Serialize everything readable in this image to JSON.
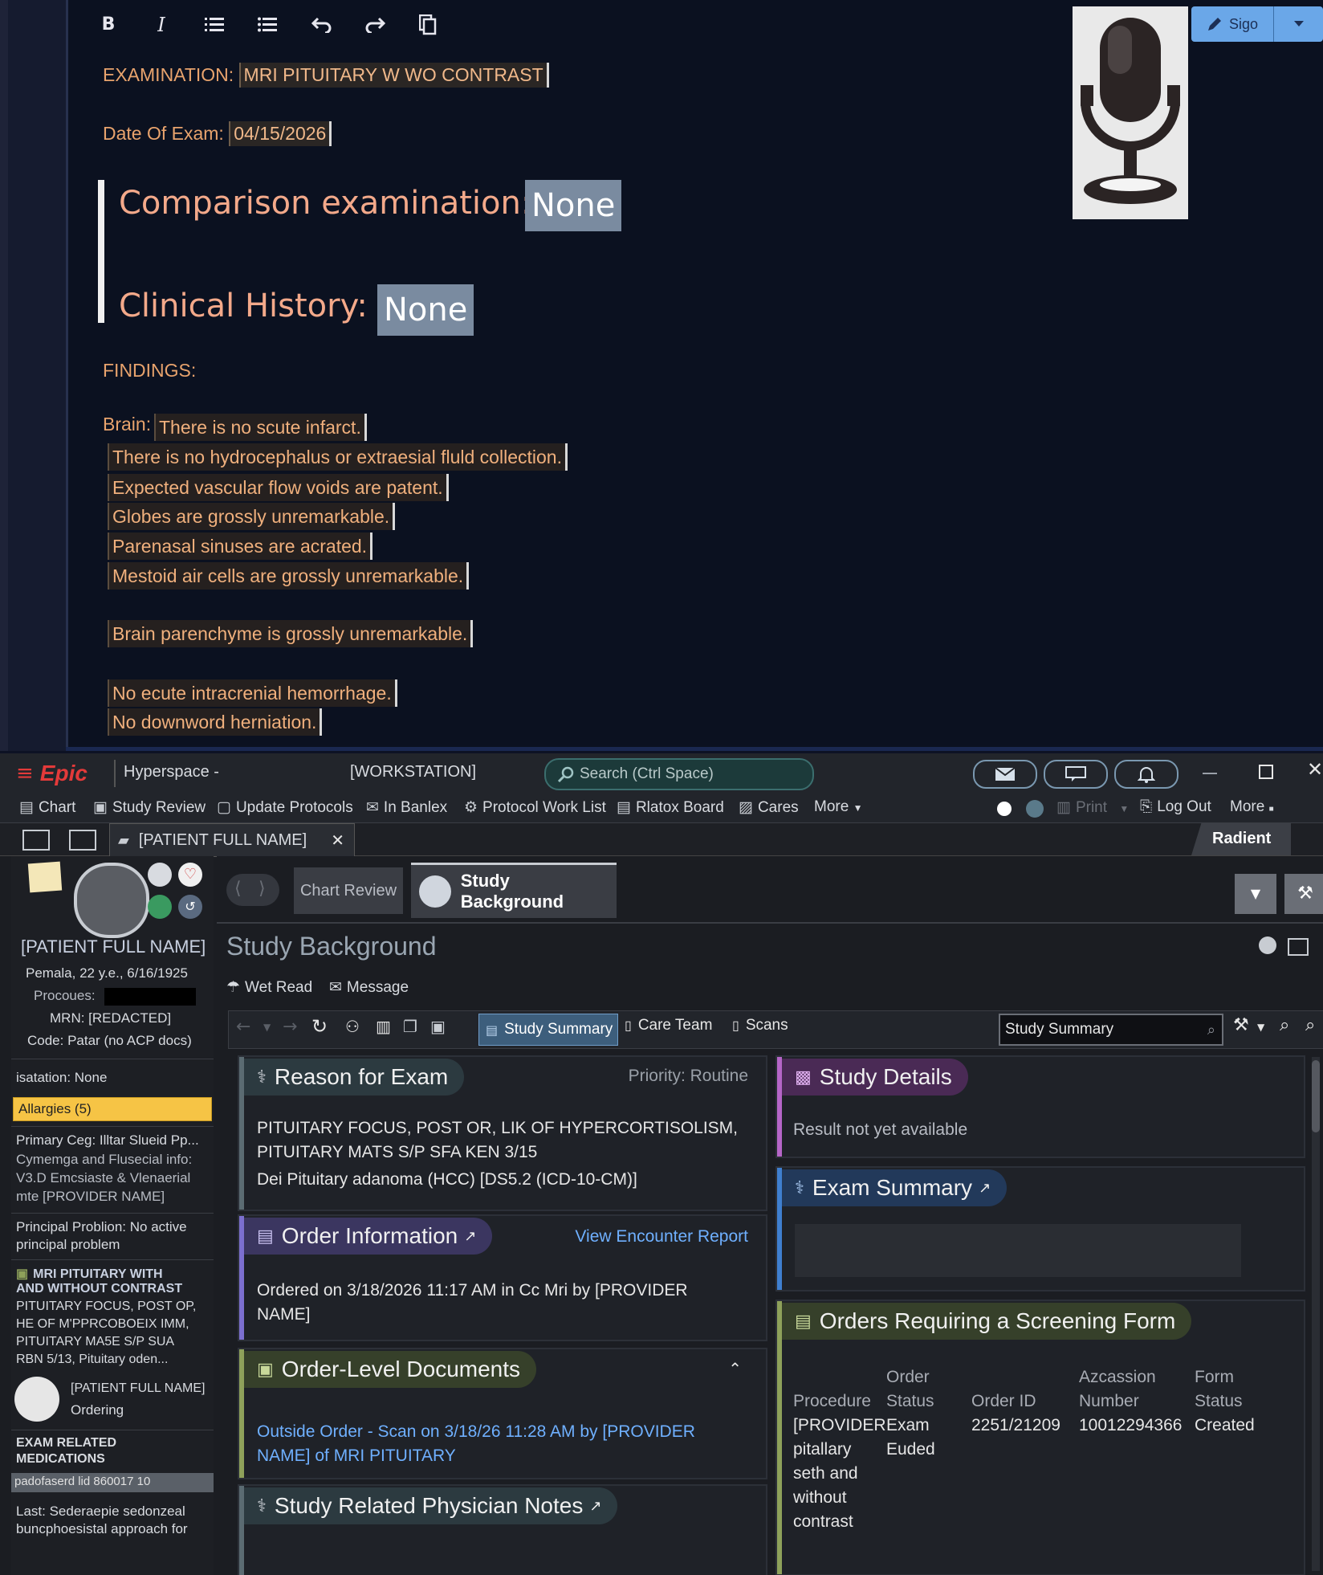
{
  "editor": {
    "toolbar": {
      "bold": "B",
      "italic": "I",
      "sign_label": "Sigo"
    },
    "examination_label": "EXAMINATION:",
    "examination_value": "MRI PITUITARY W WO CONTRAST",
    "date_label": "Date Of Exam:",
    "date_value": "04/15/2026",
    "comparison_label": "Comparison examination:",
    "comparison_value": "None",
    "history_label": "Clinical History:",
    "history_value": "None",
    "findings_label": "FINDINGS:",
    "brain_label": "Brain:",
    "findings": [
      "There is no scute infarct.",
      "There is no hydrocephalus or extraesial fluld collection.",
      "Expected vascular flow voids are patent.",
      "Globes are grossly unremarkable.",
      "Parenasal sinuses are acrated.",
      "Mestoid air cells are grossly unremarkable.",
      "Brain parenchyme is grossly unremarkable.",
      "No ecute intracrenial hemorrhage.",
      "No downword herniation."
    ]
  },
  "epic": {
    "logo": "Epic",
    "app_name": "Hyperspace -",
    "workstation": "[WORKSTATION]",
    "search_placeholder": "Search (Ctrl Space)",
    "menu": [
      {
        "label": "Chart"
      },
      {
        "label": "Study Review"
      },
      {
        "label": "Update Protocols"
      },
      {
        "label": "In Banlex"
      },
      {
        "label": "Protocol Work List"
      },
      {
        "label": "Rlatox Board"
      },
      {
        "label": "Cares"
      },
      {
        "label": "More"
      }
    ],
    "right_menu": {
      "print": "Print",
      "logout": "Log Out",
      "more": "More",
      "brand": "Radient"
    },
    "patient_tab": "[PATIENT FULL NAME]",
    "patient": {
      "name": "[PATIENT FULL NAME]",
      "demographics": "Pemala, 22 y.e., 6/16/1925",
      "procoues_label": "Procoues:",
      "mrn": "MRN: [REDACTED]",
      "code": "Code: Patar (no ACP docs)",
      "isolation": "isatation: None",
      "allergies": "Allargies (5)",
      "primary_care": "Primary Ceg: Illtar Slueid Pp...",
      "contact_1": "Cymemga and Flusecial info:",
      "contact_2": "V3.D Emcsiaste & Vlenaerial",
      "contact_3": "mte [PROVIDER NAME]",
      "problem_1": "Principal Problion: No active",
      "problem_2": "principal problem",
      "order_title_1": "MRI PITUITARY WITH",
      "order_title_2": "AND WITHOUT CONTRAST",
      "order_line_1": "PITUITARY FOCUS, POST OP,",
      "order_line_2": "HE OF M'PPRCOBOEIX IMM,",
      "order_line_3": "PITUITARY MA5E S/P SUA",
      "order_line_4": "RBN 5/13, Pituitary oden...",
      "ordering_name": "[PATIENT FULL NAME]",
      "ordering_label": "Ordering",
      "meds_header_1": "EXAM RELATED",
      "meds_header_2": "MEDICATIONS",
      "med_row": "padofaserd lid 860017 10",
      "last_1": "Last: Sederaepie sedonzeal",
      "last_2": "buncphoesistal approach for"
    },
    "activity_tabs": {
      "chart_review": "Chart Review",
      "study_background": "Study Background"
    },
    "page_title": "Study Background",
    "actions": {
      "wet_read": "Wet Read",
      "message": "Message"
    },
    "sub_tabs": [
      "Study Summary",
      "Care Team",
      "Scans"
    ],
    "sub_search_value": "Study Summary",
    "reason_for_exam": {
      "title": "Reason for Exam",
      "priority": "Priority: Routine",
      "line_1": "PITUITARY FOCUS, POST OR, LIK OF HYPERCORTISOLISM,",
      "line_2": "PITUITARY MATS S/P SFA KEN 3/15",
      "line_3": "Dei Pituitary adanoma (HCC) [DS5.2 (ICD-10-CM)]"
    },
    "order_information": {
      "title": "Order Information",
      "link": "View Encounter Report",
      "line_1": "Ordered on 3/18/2026 11:17 AM in Cc Mri by [PROVIDER",
      "line_2": "NAME]"
    },
    "order_documents": {
      "title": "Order-Level Documents",
      "line_1": "Outside Order - Scan on 3/18/26 11:28 AM by [PROVIDER",
      "line_2": "NAME] of MRI PITUITARY"
    },
    "physician_notes": {
      "title": "Study Related Physician Notes"
    },
    "study_details": {
      "title": "Study Details",
      "body": "Result not yet available"
    },
    "exam_summary": {
      "title": "Exam Summary"
    },
    "screening": {
      "title": "Orders Requiring a Screening Form",
      "headers": {
        "procedure": "Procedure",
        "order_status_1": "Order",
        "order_status_2": "Status",
        "order_id": "Order ID",
        "accession_1": "Azcassion",
        "accession_2": "Number",
        "form_status_1": "Form",
        "form_status_2": "Status"
      },
      "row": {
        "procedure": [
          "[PROVIDER",
          "pitallary",
          "seth and",
          "without",
          "contrast"
        ],
        "order_status": [
          "Exam",
          "Euded"
        ],
        "order_id": "2251/21209",
        "accession": "10012294366",
        "form_status": "Created"
      }
    },
    "colors": {
      "reason_accent": "#5b6b72",
      "order_info_accent": "#7c6fcf",
      "documents_accent": "#8ea15a",
      "notes_accent": "#5b6b72",
      "study_details_accent": "#b565c7",
      "exam_summary_accent": "#3f7fcf",
      "screening_accent": "#8ea15a",
      "allergy_bg": "#f6c445"
    }
  }
}
